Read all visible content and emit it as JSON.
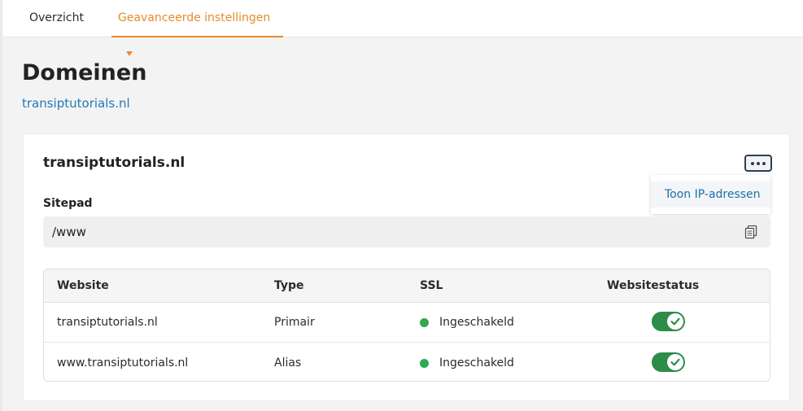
{
  "tabs": {
    "overview": "Overzicht",
    "advanced": "Geavanceerde instellingen"
  },
  "header": {
    "title": "Domeinen",
    "domain_link": "transiptutorials.nl"
  },
  "card": {
    "title": "transiptutorials.nl",
    "more_icon": "ellipsis-icon",
    "dropdown_item": "Toon IP-adressen",
    "sitepad_label": "Sitepad",
    "sitepad_value": "/www",
    "copy_icon": "copy-icon"
  },
  "table": {
    "headers": [
      "Website",
      "Type",
      "SSL",
      "Websitestatus"
    ],
    "rows": [
      {
        "website": "transiptutorials.nl",
        "type": "Primair",
        "ssl": "Ingeschakeld",
        "status": "on"
      },
      {
        "website": "www.transiptutorials.nl",
        "type": "Alias",
        "ssl": "Ingeschakeld",
        "status": "on"
      }
    ]
  },
  "colors": {
    "accent": "#e98a2c",
    "link": "#1f7ab8",
    "ssl_ok": "#2fa84f",
    "toggle_on": "#2c8c48"
  }
}
